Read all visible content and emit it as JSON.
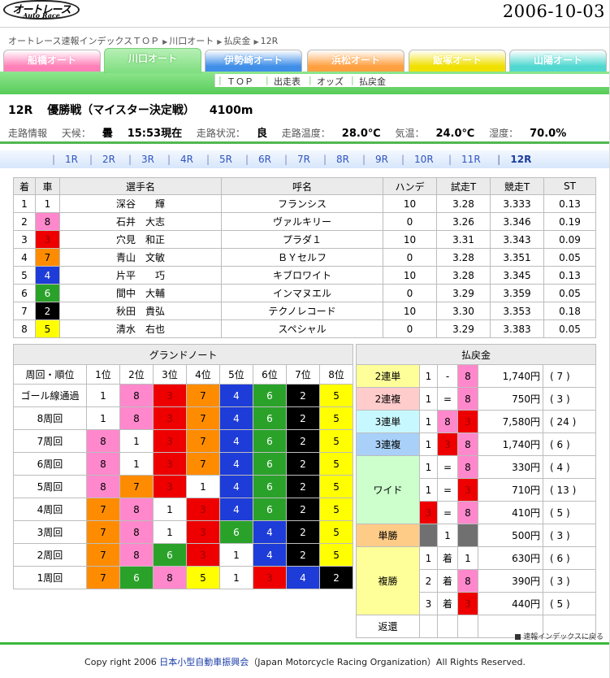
{
  "header": {
    "logo_main": "オートレース",
    "logo_sub": "Auto Race",
    "date": "2006-10-03"
  },
  "breadcrumb": [
    "オートレース速報インデックスＴＯＰ",
    "川口オート",
    "払戻金",
    "12R"
  ],
  "venue_tabs": [
    {
      "label": "船橋オート",
      "color": "#ff80b8",
      "active": false
    },
    {
      "label": "川口オート",
      "color": "#7ede7e",
      "active": true
    },
    {
      "label": "伊勢崎オート",
      "color": "#3f8ee8",
      "active": false
    },
    {
      "label": "浜松オート",
      "color": "#ffa040",
      "active": false
    },
    {
      "label": "飯塚オート",
      "color": "#f0e000",
      "active": false
    },
    {
      "label": "山陽オート",
      "color": "#50d8d0",
      "active": false
    }
  ],
  "sub_nav": [
    "ＴＯＰ",
    "出走表",
    "オッズ",
    "払戻金"
  ],
  "race": {
    "number": "12R",
    "name": "優勝戦（マイスター決定戦）",
    "distance": "4100m"
  },
  "conditions": {
    "label": "走路情報",
    "weather_label": "天候：",
    "weather": "曇",
    "time": "15:53現在",
    "track_label": "走路状況：",
    "track": "良",
    "track_temp_label": "走路温度：",
    "track_temp": "28.0℃",
    "air_temp_label": "気温：",
    "air_temp": "24.0℃",
    "humidity_label": "湿度：",
    "humidity": "70.0%"
  },
  "race_nav": [
    "1R",
    "2R",
    "3R",
    "4R",
    "5R",
    "6R",
    "7R",
    "8R",
    "9R",
    "10R",
    "11R",
    "12R"
  ],
  "current_race": "12R",
  "results": {
    "headers": [
      "着",
      "車",
      "選手名",
      "呼名",
      "ハンデ",
      "試走T",
      "競走T",
      "ST"
    ],
    "rows": [
      [
        "1",
        "1",
        "深谷　　輝",
        "フランシス",
        "10",
        "3.28",
        "3.333",
        "0.13"
      ],
      [
        "2",
        "8",
        "石井　大志",
        "ヴァルキリー",
        "0",
        "3.26",
        "3.346",
        "0.19"
      ],
      [
        "3",
        "3",
        "穴見　和正",
        "プラダ１",
        "10",
        "3.31",
        "3.343",
        "0.09"
      ],
      [
        "4",
        "7",
        "青山　文敏",
        "ＢＹセルフ",
        "0",
        "3.28",
        "3.351",
        "0.05"
      ],
      [
        "5",
        "4",
        "片平　　巧",
        "キブロワイト",
        "10",
        "3.28",
        "3.345",
        "0.13"
      ],
      [
        "6",
        "6",
        "間中　大輔",
        "インマヌエル",
        "0",
        "3.29",
        "3.359",
        "0.05"
      ],
      [
        "7",
        "2",
        "秋田　貴弘",
        "テクノレコード",
        "10",
        "3.30",
        "3.353",
        "0.18"
      ],
      [
        "8",
        "5",
        "清水　右也",
        "スペシャル",
        "0",
        "3.29",
        "3.383",
        "0.05"
      ]
    ]
  },
  "grand_note": {
    "title": "グランドノート",
    "headers": [
      "周回・順位",
      "1位",
      "2位",
      "3位",
      "4位",
      "5位",
      "6位",
      "7位",
      "8位"
    ],
    "rows": [
      {
        "lap": "ゴール線通過",
        "cars": [
          "1",
          "8",
          "3",
          "7",
          "4",
          "6",
          "2",
          "5"
        ]
      },
      {
        "lap": "8周回",
        "cars": [
          "1",
          "8",
          "3",
          "7",
          "4",
          "6",
          "2",
          "5"
        ]
      },
      {
        "lap": "7周回",
        "cars": [
          "8",
          "1",
          "3",
          "7",
          "4",
          "6",
          "2",
          "5"
        ]
      },
      {
        "lap": "6周回",
        "cars": [
          "8",
          "1",
          "3",
          "7",
          "4",
          "6",
          "2",
          "5"
        ]
      },
      {
        "lap": "5周回",
        "cars": [
          "8",
          "7",
          "3",
          "1",
          "4",
          "6",
          "2",
          "5"
        ]
      },
      {
        "lap": "4周回",
        "cars": [
          "7",
          "8",
          "1",
          "3",
          "4",
          "6",
          "2",
          "5"
        ]
      },
      {
        "lap": "3周回",
        "cars": [
          "7",
          "8",
          "1",
          "3",
          "6",
          "4",
          "2",
          "5"
        ]
      },
      {
        "lap": "2周回",
        "cars": [
          "7",
          "8",
          "6",
          "3",
          "1",
          "4",
          "2",
          "5"
        ]
      },
      {
        "lap": "1周回",
        "cars": [
          "7",
          "6",
          "8",
          "5",
          "1",
          "3",
          "4",
          "2"
        ]
      }
    ]
  },
  "payout": {
    "title": "払戻金",
    "rows": [
      {
        "type": "2連単",
        "combo": [
          "1",
          "-",
          "8"
        ],
        "amount": "1,740円",
        "pop": "( 7 )"
      },
      {
        "type": "2連複",
        "combo": [
          "1",
          "=",
          "8"
        ],
        "amount": "750円",
        "pop": "( 3 )"
      },
      {
        "type": "3連単",
        "combo": [
          "1",
          "8",
          "3"
        ],
        "amount": "7,580円",
        "pop": "( 24 )"
      },
      {
        "type": "3連複",
        "combo": [
          "1",
          "3",
          "8"
        ],
        "amount": "1,740円",
        "pop": "( 6 )"
      },
      {
        "type": "ワイド",
        "combo": [
          "1",
          "=",
          "8"
        ],
        "amount": "330円",
        "pop": "( 4 )"
      },
      {
        "type": "",
        "combo": [
          "1",
          "=",
          "3"
        ],
        "amount": "710円",
        "pop": "( 13 )"
      },
      {
        "type": "",
        "combo": [
          "3",
          "=",
          "8"
        ],
        "amount": "410円",
        "pop": "( 5 )"
      },
      {
        "type": "単勝",
        "combo": [
          "",
          "1",
          ""
        ],
        "amount": "500円",
        "pop": "( 3 )"
      },
      {
        "type": "複勝",
        "combo": [
          "1",
          "着",
          "1"
        ],
        "amount": "630円",
        "pop": "( 6 )"
      },
      {
        "type": "",
        "combo": [
          "2",
          "着",
          "8"
        ],
        "amount": "390円",
        "pop": "( 3 )"
      },
      {
        "type": "",
        "combo": [
          "3",
          "着",
          "3"
        ],
        "amount": "440円",
        "pop": "( 5 )"
      },
      {
        "type": "返還",
        "combo": [
          "",
          "",
          ""
        ],
        "amount": "",
        "pop": ""
      }
    ]
  },
  "back_link": "速報インデックスに戻る",
  "footer": {
    "prefix": "Copy right 2006 ",
    "org_link": "日本小型自動車振興会",
    "suffix": "（Japan Motorcycle Racing Organization）All Rights Reserved."
  },
  "colors": {
    "car1": "#ffffff",
    "car2": "#000000",
    "car3": "#ee0000",
    "car4": "#1e3cd8",
    "car5": "#ffff00",
    "car6": "#2aa22a",
    "car7": "#ff8c00",
    "car8": "#ff88cc",
    "accent_green": "#50b850"
  }
}
